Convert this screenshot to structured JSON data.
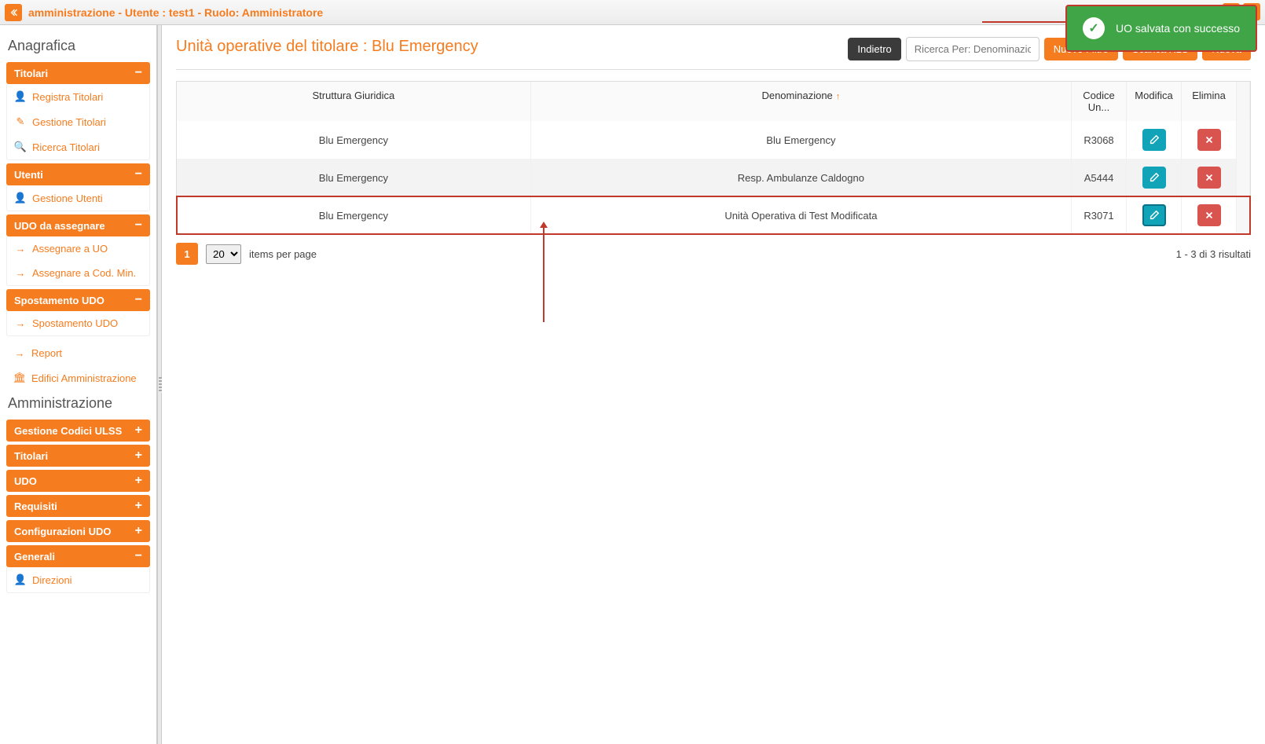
{
  "topbar": {
    "title": "amministrazione - Utente : test1 - Ruolo: Amministratore"
  },
  "toast": {
    "message": "UO salvata con successo"
  },
  "sidebar": {
    "heading1": "Anagrafica",
    "titolari": {
      "header": "Titolari",
      "items": [
        {
          "label": "Registra Titolari",
          "icon": "user-plus"
        },
        {
          "label": "Gestione Titolari",
          "icon": "edit"
        },
        {
          "label": "Ricerca Titolari",
          "icon": "search"
        }
      ]
    },
    "utenti": {
      "header": "Utenti",
      "items": [
        {
          "label": "Gestione Utenti",
          "icon": "user-cog"
        }
      ]
    },
    "udoAssegnare": {
      "header": "UDO da assegnare",
      "items": [
        {
          "label": "Assegnare a UO",
          "icon": "arrow-right"
        },
        {
          "label": "Assegnare a Cod. Min.",
          "icon": "arrow-right"
        }
      ]
    },
    "spostamento": {
      "header": "Spostamento UDO",
      "items": [
        {
          "label": "Spostamento UDO",
          "icon": "arrow-right"
        }
      ]
    },
    "standalone": [
      {
        "label": "Report",
        "icon": "arrow-right"
      },
      {
        "label": "Edifici Amministrazione",
        "icon": "building"
      }
    ],
    "heading2": "Amministrazione",
    "collapsed": [
      {
        "label": "Gestione Codici ULSS"
      },
      {
        "label": "Titolari"
      },
      {
        "label": "UDO"
      },
      {
        "label": "Requisiti"
      },
      {
        "label": "Configurazioni UDO"
      }
    ],
    "generali": {
      "header": "Generali",
      "items": [
        {
          "label": "Direzioni",
          "icon": "user"
        }
      ]
    }
  },
  "main": {
    "title": "Unità operative del titolare : Blu Emergency",
    "buttons": {
      "back": "Indietro",
      "newFilter": "Nuovo Filtro",
      "exportXls": "Scarica XLS",
      "new": "Nuova"
    },
    "search": {
      "placeholder": "Ricerca Per: Denominazione"
    },
    "columns": {
      "structure": "Struttura Giuridica",
      "denomination": "Denominazione",
      "code": "Codice Un...",
      "modify": "Modifica",
      "delete": "Elimina"
    },
    "rows": [
      {
        "structure": "Blu Emergency",
        "denomination": "Blu Emergency",
        "code": "R3068",
        "highlight": false
      },
      {
        "structure": "Blu Emergency",
        "denomination": "Resp. Ambulanze Caldogno",
        "code": "A5444",
        "highlight": false
      },
      {
        "structure": "Blu Emergency",
        "denomination": "Unità Operativa di Test Modificata",
        "code": "R3071",
        "highlight": true
      }
    ],
    "pager": {
      "current": "1",
      "perPage": "20",
      "label": "items per page",
      "summary": "1 - 3 di 3 risultati"
    }
  }
}
